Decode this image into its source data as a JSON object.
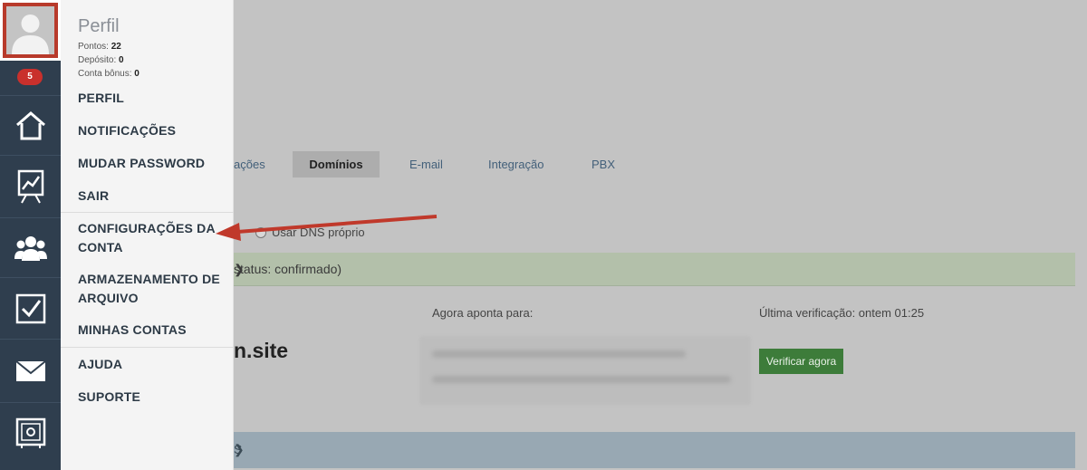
{
  "sidebar": {
    "badge_count": "5",
    "icons": [
      "home-icon",
      "presentation-chart-icon",
      "team-icon",
      "checkbox-icon",
      "mail-icon",
      "safe-icon"
    ]
  },
  "menu": {
    "title": "Perfil",
    "stats": {
      "pontos_label": "Pontos:",
      "pontos_value": "22",
      "deposito_label": "Depósito:",
      "deposito_value": "0",
      "bonus_label": "Conta bônus:",
      "bonus_value": "0"
    },
    "items": {
      "perfil": "PERFIL",
      "notificacoes": "NOTIFICAÇÕES",
      "mudar_password": "MUDAR PASSWORD",
      "sair": "SAIR",
      "configuracoes": "CONFIGURAÇÕES DA CONTA",
      "armazenamento": "ARMAZENAMENTO DE ARQUIVO",
      "minhas_contas": "MINHAS CONTAS",
      "ajuda": "AJUDA",
      "suporte": "SUPORTE"
    }
  },
  "page": {
    "tabs": {
      "partial": "ações",
      "dominios": "Domínios",
      "email": "E-mail",
      "integracao": "Integração",
      "pbx": "PBX"
    },
    "dns_option": "Usar DNS próprio",
    "status_text": "status: confirmado)",
    "points_to_label": "Agora aponta para:",
    "last_check_label": "Última verificação: ontem 01:25",
    "domain_partial": "n.site",
    "verify_button": "Verificar agora",
    "bottom_bar_partial": "S"
  },
  "colors": {
    "sidebar_bg": "#2f3e4e",
    "avatar_border": "#b83a2b",
    "badge": "#c9302c",
    "arrow": "#c0392b",
    "verify_button": "#3d7c3a"
  }
}
